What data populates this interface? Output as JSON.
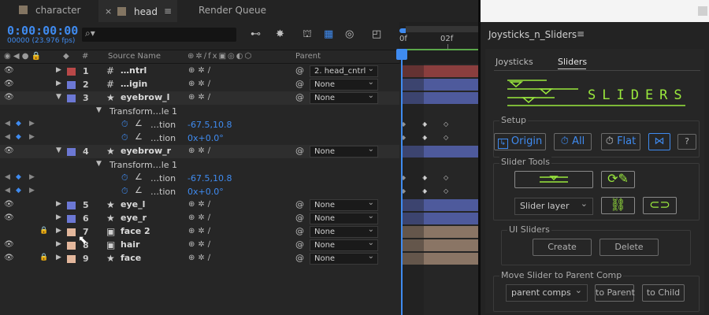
{
  "tabs": [
    {
      "label": "character",
      "color": "#837562"
    },
    {
      "label": "head",
      "color": "#837562"
    },
    {
      "label": "Render Queue"
    }
  ],
  "timeline": {
    "timecode": "0:00:00:00",
    "frames": "00000 (23.976 fps)",
    "ruler_labels": [
      "0f",
      "02f"
    ]
  },
  "columns": {
    "num": "#",
    "source": "Source Name",
    "parent": "Parent"
  },
  "layers": [
    {
      "kind": "layer",
      "num": "1",
      "color": "#b94848",
      "type": "null",
      "name": "…ntrl",
      "parent": "2. head_cntrl",
      "twirl": "▶",
      "bar": "#8a3e3e"
    },
    {
      "kind": "layer",
      "num": "2",
      "color": "#6c78d4",
      "type": "null",
      "name": "…igin",
      "parent": "None",
      "twirl": "▶",
      "bar": "#4e5a9c"
    },
    {
      "kind": "layer",
      "num": "3",
      "color": "#6c78d4",
      "type": "star",
      "name": "eyebrow_l",
      "parent": "None",
      "twirl": "▼",
      "bar": "#4e5a9c",
      "selected": true
    },
    {
      "kind": "group",
      "name": "Transform…le 1"
    },
    {
      "kind": "prop",
      "name": "…tion",
      "value": "-67.5,10.8"
    },
    {
      "kind": "prop",
      "name": "…tion",
      "value": "0x+0.0°"
    },
    {
      "kind": "layer",
      "num": "4",
      "color": "#6c78d4",
      "type": "star",
      "name": "eyebrow_r",
      "parent": "None",
      "twirl": "▼",
      "bar": "#4e5a9c",
      "selected": true
    },
    {
      "kind": "group",
      "name": "Transform…le 1"
    },
    {
      "kind": "prop",
      "name": "…tion",
      "value": "-67.5,10.8"
    },
    {
      "kind": "prop",
      "name": "…tion",
      "value": "0x+0.0°"
    },
    {
      "kind": "layer",
      "num": "5",
      "color": "#6c78d4",
      "type": "star",
      "name": "eye_l",
      "parent": "None",
      "twirl": "▶",
      "bar": "#4e5a9c"
    },
    {
      "kind": "layer",
      "num": "6",
      "color": "#6c78d4",
      "type": "star",
      "name": "eye_r",
      "parent": "None",
      "twirl": "▶",
      "bar": "#4e5a9c"
    },
    {
      "kind": "layer",
      "num": "7",
      "color": "#e3b79c",
      "type": "comp",
      "name": "face 2",
      "parent": "None",
      "twirl": "▶",
      "bar": "#8a7565",
      "locked": true,
      "hidden": true
    },
    {
      "kind": "layer",
      "num": "8",
      "color": "#e3b79c",
      "type": "comp",
      "name": "hair",
      "parent": "None",
      "twirl": "▶",
      "bar": "#8a7565"
    },
    {
      "kind": "layer",
      "num": "9",
      "color": "#e3b79c",
      "type": "star",
      "name": "face",
      "parent": "None",
      "twirl": "▶",
      "bar": "#8a7565",
      "locked": true
    }
  ],
  "panel": {
    "title": "Joysticks_n_Sliders",
    "tabs": [
      "Joysticks",
      "Sliders"
    ],
    "logo_text": "SLIDERS",
    "setup": {
      "label": "Setup",
      "origin": "Origin",
      "all": "All",
      "flat": "Flat",
      "help": "?"
    },
    "slider_tools": {
      "label": "Slider Tools",
      "dropdown": "Slider layer"
    },
    "ui_sliders": {
      "label": "UI Sliders",
      "create": "Create",
      "delete": "Delete"
    },
    "move": {
      "label": "Move Slider to Parent Comp",
      "dropdown": "parent comps",
      "to_parent": "to Parent",
      "to_child": "to Child"
    }
  },
  "colors": {
    "accent": "#3f8bf0",
    "logo_green": "#9ae83d"
  }
}
